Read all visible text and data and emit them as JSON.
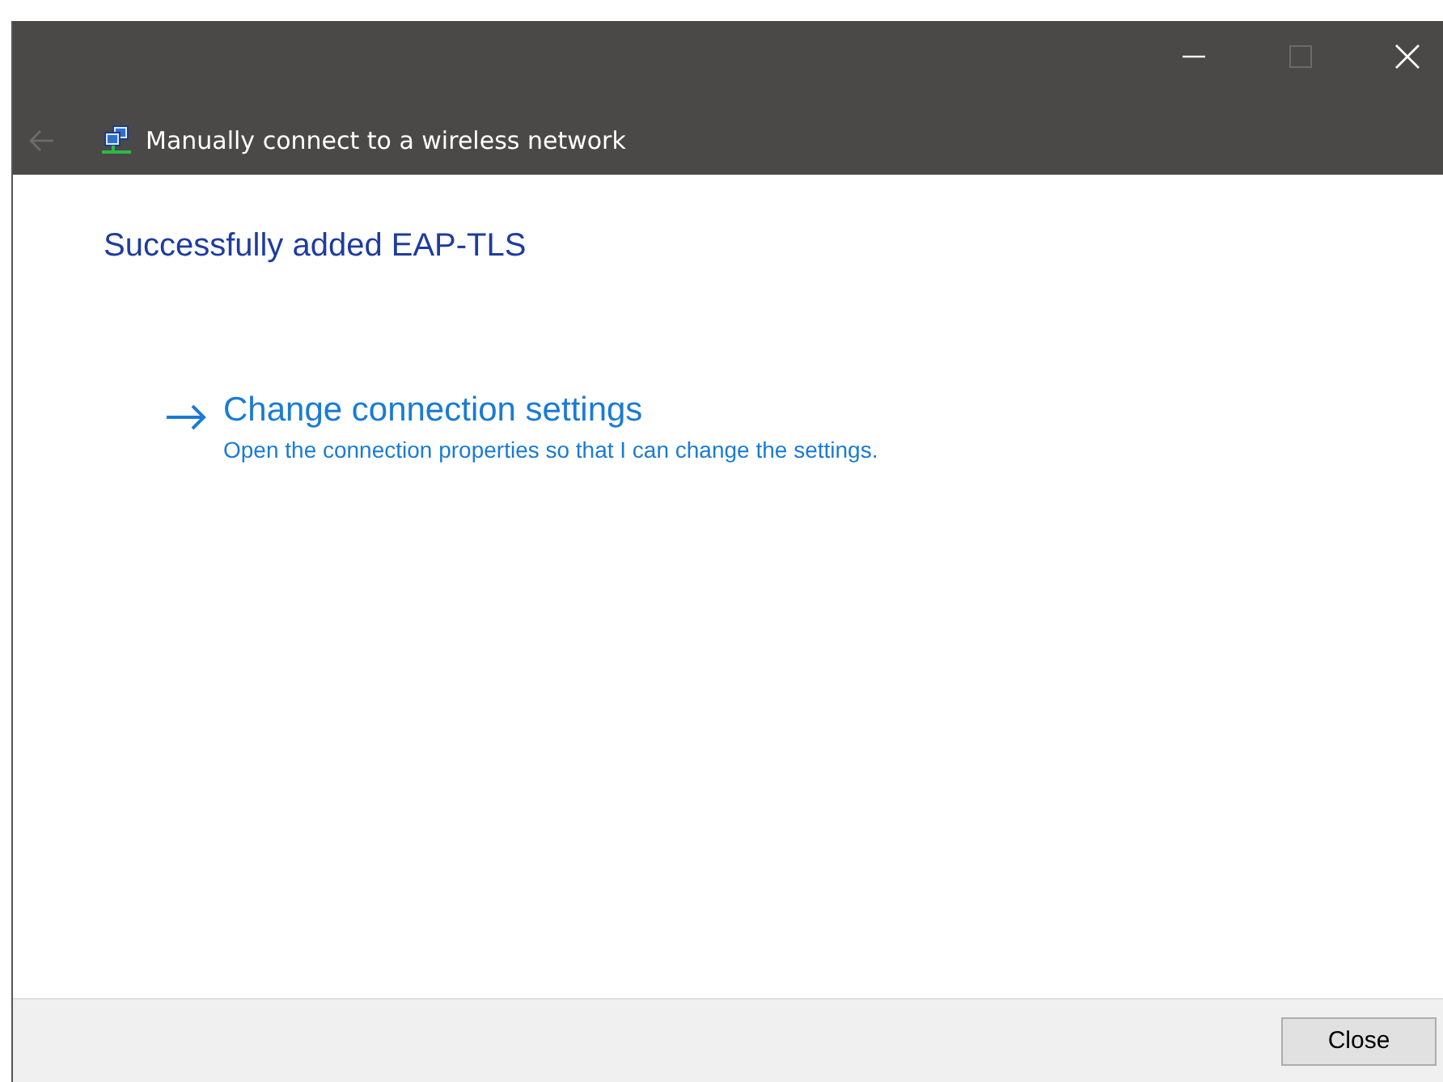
{
  "window": {
    "title": "Manually connect to a wireless network",
    "back_disabled": true,
    "maximize_disabled": true
  },
  "heading": "Successfully added EAP-TLS",
  "options": [
    {
      "title": "Change connection settings",
      "description": "Open the connection properties so that I can change the settings."
    }
  ],
  "buttons": [
    {
      "label": "Close"
    }
  ]
}
